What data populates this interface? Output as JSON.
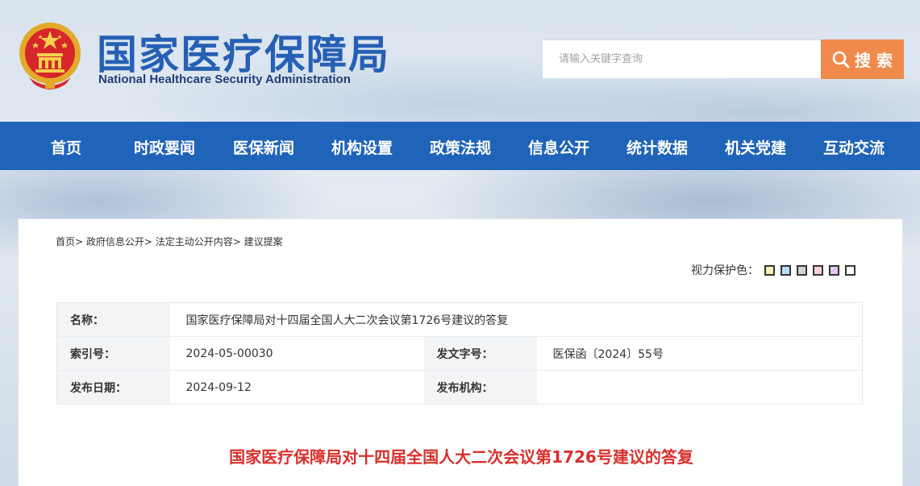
{
  "header": {
    "logo_cn": "国家医疗保障局",
    "logo_en": "National Healthcare Security Administration",
    "search_placeholder": "请输入关键字查询",
    "search_button": "搜 索"
  },
  "nav": {
    "items": [
      "首页",
      "时政要闻",
      "医保新闻",
      "机构设置",
      "政策法规",
      "信息公开",
      "统计数据",
      "机关党建",
      "互动交流"
    ]
  },
  "breadcrumb": [
    "首页>",
    "政府信息公开>",
    "法定主动公开内容>",
    "建议提案"
  ],
  "vision": {
    "label": "视力保护色：",
    "swatches": [
      "#f8f0b4",
      "#b8e0f6",
      "#d4d4d4",
      "#f8d2d8",
      "#e6c8ee",
      "#ffffff"
    ]
  },
  "meta": {
    "name_label": "名称：",
    "name_value": "国家医疗保障局对十四届全国人大二次会议第1726号建议的答复",
    "index_label": "索引号：",
    "index_value": "2024-05-00030",
    "docno_label": "发文字号：",
    "docno_value": "医保函〔2024〕55号",
    "date_label": "发布日期：",
    "date_value": "2024-09-12",
    "org_label": "发布机构：",
    "org_value": ""
  },
  "document": {
    "title": "国家医疗保障局对十四届全国人大二次会议第1726号建议的答复"
  },
  "colors": {
    "nav_bg": "#1f64b8",
    "logo_blue": "#2660b5",
    "search_btn": "#ef8a4a",
    "title_red": "#d9302c"
  }
}
